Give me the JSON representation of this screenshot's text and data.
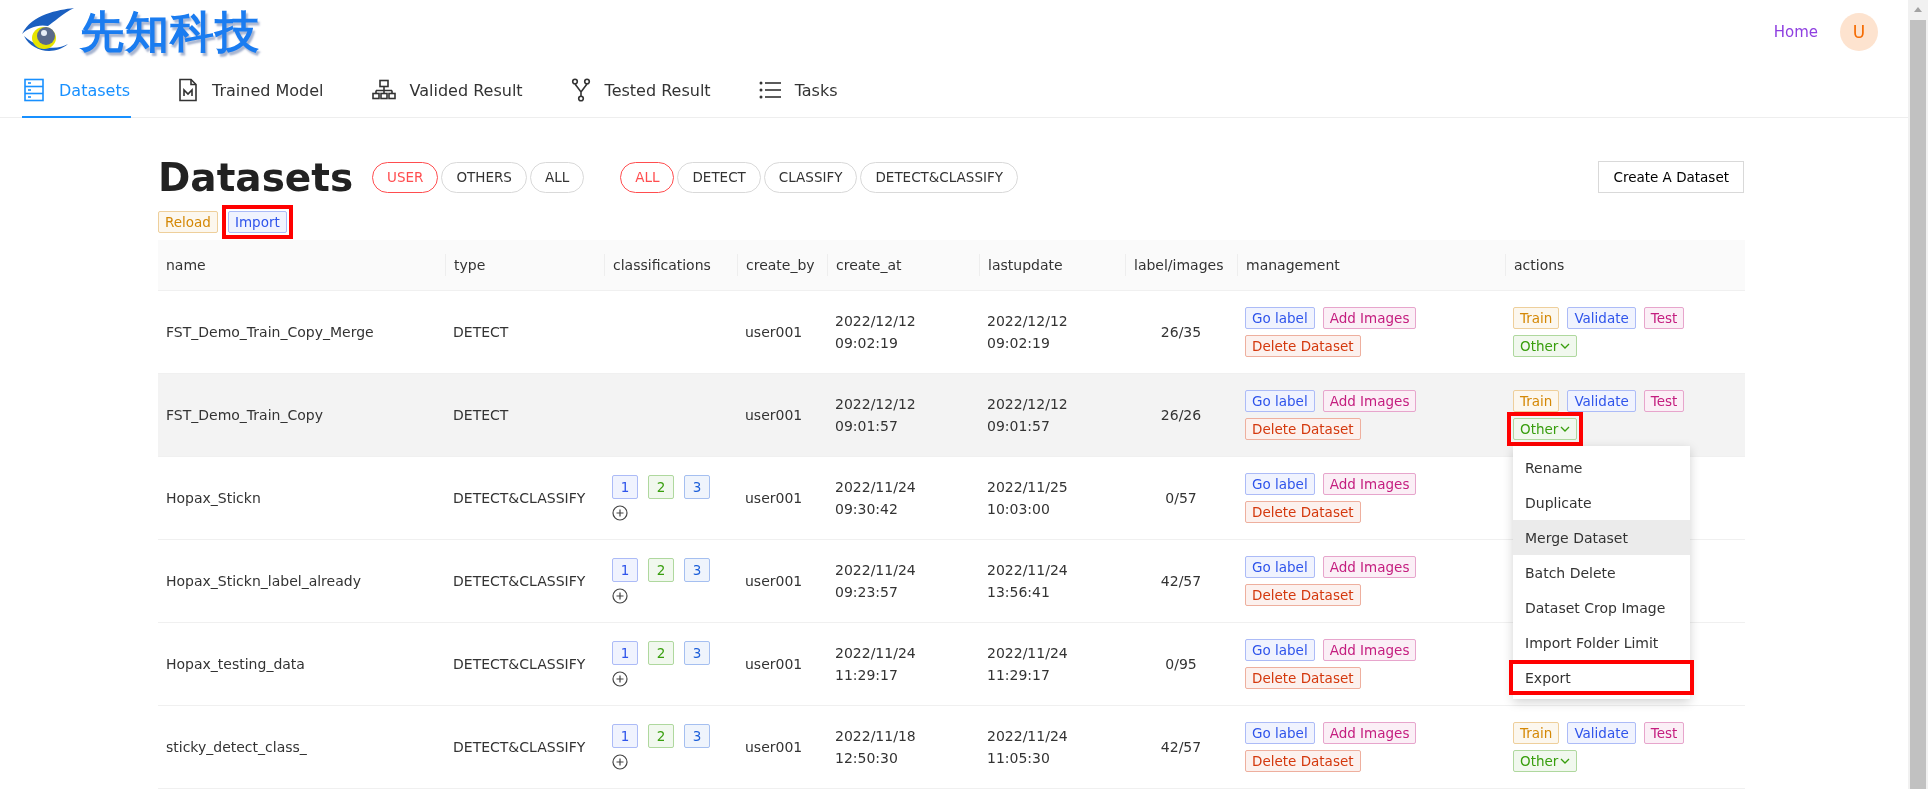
{
  "header": {
    "logo_text": "先知科技",
    "home_link": "Home",
    "avatar": "U"
  },
  "nav_tabs": [
    {
      "label": "Datasets",
      "kind": "database",
      "selected": true
    },
    {
      "label": "Trained Model",
      "kind": "document",
      "selected": false
    },
    {
      "label": "Valided Result",
      "kind": "sitemap",
      "selected": false
    },
    {
      "label": "Tested Result",
      "kind": "fork",
      "selected": false
    },
    {
      "label": "Tasks",
      "kind": "list",
      "selected": false
    }
  ],
  "page": {
    "title": "Datasets",
    "owner_filters": [
      {
        "label": "USER",
        "selected": true
      },
      {
        "label": "OTHERS",
        "selected": false
      },
      {
        "label": "ALL",
        "selected": false
      }
    ],
    "type_filters": [
      {
        "label": "ALL",
        "selected": true
      },
      {
        "label": "DETECT",
        "selected": false
      },
      {
        "label": "CLASSIFY",
        "selected": false
      },
      {
        "label": "DETECT&CLASSIFY",
        "selected": false
      }
    ],
    "create_button": "Create A Dataset",
    "toolbar": [
      {
        "label": "Reload",
        "color": "#d48806",
        "highlighted": false
      },
      {
        "label": "Import",
        "color": "#2f54eb",
        "highlighted": true
      }
    ]
  },
  "table": {
    "columns": [
      "name",
      "type",
      "classifications",
      "create_by",
      "create_at",
      "lastupdate",
      "label/images",
      "management",
      "actions"
    ],
    "rows": [
      {
        "name": "FST_Demo_Train_Copy_Merge",
        "type": "DETECT",
        "create_by": "user001",
        "create_at": "2022/12/12 09:02:19",
        "lastupdate": "2022/12/12 09:02:19",
        "label_images": "26/35",
        "hovered": false,
        "management": [
          {
            "label": "Go label",
            "color": "#2f54eb"
          },
          {
            "label": "Add Images",
            "color": "#c41d7f"
          },
          {
            "label": "Delete Dataset",
            "color": "#d4380d"
          }
        ],
        "actions": [
          {
            "label": "Train",
            "color": "#d48806",
            "kind": "tag",
            "highlighted": false
          },
          {
            "label": "Validate",
            "color": "#2f54eb",
            "kind": "tag",
            "highlighted": false
          },
          {
            "label": "Test",
            "color": "#c41d7f",
            "kind": "tag",
            "highlighted": false
          },
          {
            "label": "Other",
            "color": "#389e0d",
            "kind": "dropdown",
            "highlighted": false
          }
        ]
      },
      {
        "name": "FST_Demo_Train_Copy",
        "type": "DETECT",
        "create_by": "user001",
        "create_at": "2022/12/12 09:01:57",
        "lastupdate": "2022/12/12 09:01:57",
        "label_images": "26/26",
        "hovered": true,
        "management": [
          {
            "label": "Go label",
            "color": "#2f54eb"
          },
          {
            "label": "Add Images",
            "color": "#c41d7f"
          },
          {
            "label": "Delete Dataset",
            "color": "#d4380d"
          }
        ],
        "actions": [
          {
            "label": "Train",
            "color": "#d48806",
            "kind": "tag",
            "highlighted": false
          },
          {
            "label": "Validate",
            "color": "#2f54eb",
            "kind": "tag",
            "highlighted": false
          },
          {
            "label": "Test",
            "color": "#c41d7f",
            "kind": "tag",
            "highlighted": false
          },
          {
            "label": "Other",
            "color": "#389e0d",
            "kind": "dropdown",
            "highlighted": true
          }
        ],
        "menu": [
          {
            "label": "Rename",
            "hovered": false,
            "highlighted": false
          },
          {
            "label": "Duplicate",
            "hovered": false,
            "highlighted": false
          },
          {
            "label": "Merge Dataset",
            "hovered": true,
            "highlighted": false
          },
          {
            "label": "Batch Delete",
            "hovered": false,
            "highlighted": false
          },
          {
            "label": "Dataset Crop Image",
            "hovered": false,
            "highlighted": false
          },
          {
            "label": "Import Folder Limit",
            "hovered": false,
            "highlighted": false
          },
          {
            "label": "Export",
            "hovered": false,
            "highlighted": true
          }
        ]
      },
      {
        "name": "Hopax_Stickn",
        "type": "DETECT&CLASSIFY",
        "classifications": [
          {
            "label": "1",
            "color": "#2f54eb"
          },
          {
            "label": "2",
            "color": "#389e0d"
          },
          {
            "label": "3",
            "color": "#1d5fd9"
          }
        ],
        "create_by": "user001",
        "create_at": "2022/11/24 09:30:42",
        "lastupdate": "2022/11/25 10:03:00",
        "label_images": "0/57",
        "hovered": false,
        "management": [
          {
            "label": "Go label",
            "color": "#2f54eb"
          },
          {
            "label": "Add Images",
            "color": "#c41d7f"
          },
          {
            "label": "Delete Dataset",
            "color": "#d4380d"
          }
        ]
      },
      {
        "name": "Hopax_Stickn_label_already",
        "type": "DETECT&CLASSIFY",
        "classifications": [
          {
            "label": "1",
            "color": "#2f54eb"
          },
          {
            "label": "2",
            "color": "#389e0d"
          },
          {
            "label": "3",
            "color": "#1d5fd9"
          }
        ],
        "create_by": "user001",
        "create_at": "2022/11/24 09:23:57",
        "lastupdate": "2022/11/24 13:56:41",
        "label_images": "42/57",
        "hovered": false,
        "management": [
          {
            "label": "Go label",
            "color": "#2f54eb"
          },
          {
            "label": "Add Images",
            "color": "#c41d7f"
          },
          {
            "label": "Delete Dataset",
            "color": "#d4380d"
          }
        ]
      },
      {
        "name": "Hopax_testing_data",
        "type": "DETECT&CLASSIFY",
        "classifications": [
          {
            "label": "1",
            "color": "#2f54eb"
          },
          {
            "label": "2",
            "color": "#389e0d"
          },
          {
            "label": "3",
            "color": "#1d5fd9"
          }
        ],
        "create_by": "user001",
        "create_at": "2022/11/24 11:29:17",
        "lastupdate": "2022/11/24 11:29:17",
        "label_images": "0/95",
        "hovered": false,
        "management": [
          {
            "label": "Go label",
            "color": "#2f54eb"
          },
          {
            "label": "Add Images",
            "color": "#c41d7f"
          },
          {
            "label": "Delete Dataset",
            "color": "#d4380d"
          }
        ]
      },
      {
        "name": "sticky_detect_class_",
        "type": "DETECT&CLASSIFY",
        "classifications": [
          {
            "label": "1",
            "color": "#2f54eb"
          },
          {
            "label": "2",
            "color": "#389e0d"
          },
          {
            "label": "3",
            "color": "#1d5fd9"
          }
        ],
        "create_by": "user001",
        "create_at": "2022/11/18 12:50:30",
        "lastupdate": "2022/11/24 11:05:30",
        "label_images": "42/57",
        "hovered": false,
        "management": [
          {
            "label": "Go label",
            "color": "#2f54eb"
          },
          {
            "label": "Add Images",
            "color": "#c41d7f"
          },
          {
            "label": "Delete Dataset",
            "color": "#d4380d"
          }
        ],
        "actions": [
          {
            "label": "Train",
            "color": "#d48806",
            "kind": "tag",
            "highlighted": false
          },
          {
            "label": "Validate",
            "color": "#2f54eb",
            "kind": "tag",
            "highlighted": false
          },
          {
            "label": "Test",
            "color": "#c41d7f",
            "kind": "tag",
            "highlighted": false
          },
          {
            "label": "Other",
            "color": "#389e0d",
            "kind": "dropdown",
            "highlighted": false
          }
        ]
      }
    ]
  }
}
